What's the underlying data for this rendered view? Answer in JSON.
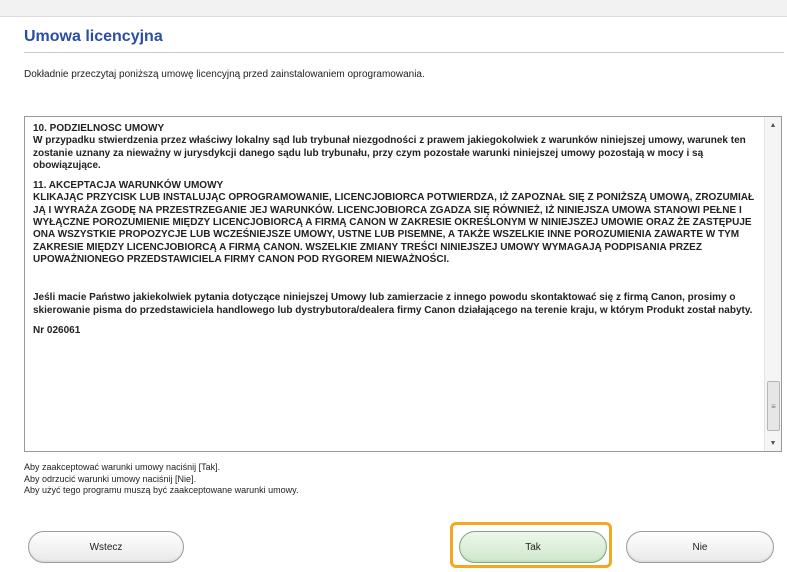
{
  "title": "Umowa licencyjna",
  "instruction": "Dokładnie przeczytaj poniższą umowę licencyjną przed zainstalowaniem oprogramowania.",
  "license": {
    "s10_heading": "10. PODZIELNOŚĆ UMOWY",
    "s10_body": "W przypadku stwierdzenia przez właściwy lokalny sąd lub trybunał niezgodności z prawem jakiegokolwiek z warunków niniejszej umowy, warunek ten zostanie uznany za nieważny w jurysdykcji danego sądu lub trybunału, przy czym pozostałe warunki niniejszej umowy pozostają w mocy i są obowiązujące.",
    "s11_heading": "11. AKCEPTACJA WARUNKÓW UMOWY",
    "s11_body": "KLIKAJĄC PRZYCISK LUB INSTALUJĄC OPROGRAMOWANIE, LICENCJOBIORCA POTWIERDZA, IŻ ZAPOZNAŁ SIĘ Z PONIŻSZĄ UMOWĄ, ZROZUMIAŁ JĄ I WYRAŻA ZGODĘ NA PRZESTRZEGANIE JEJ WARUNKÓW. LICENCJOBIORCA ZGADZA SIĘ RÓWNIEŻ, IŻ NINIEJSZA UMOWA STANOWI PEŁNE I WYŁĄCZNE POROZUMIENIE MIĘDZY LICENCJOBIORCĄ A FIRMĄ CANON W ZAKRESIE OKREŚLONYM W NINIEJSZEJ UMOWIE ORAZ ŻE ZASTĘPUJE ONA WSZYSTKIE PROPOZYCJE LUB WCZEŚNIEJSZE UMOWY, USTNE LUB PISEMNE, A TAKŻE WSZELKIE INNE POROZUMIENIA ZAWARTE W TYM ZAKRESIE MIĘDZY LICENCJOBIORCĄ A FIRMĄ CANON. WSZELKIE ZMIANY TREŚCI NINIEJSZEJ UMOWY WYMAGAJĄ PODPISANIA PRZEZ UPOWAŻNIONEGO PRZEDSTAWICIELA FIRMY CANON POD RYGOREM NIEWAŻNOŚCI.",
    "contact": "Jeśli macie Państwo jakiekolwiek pytania dotyczące niniejszej Umowy lub zamierzacie z innego powodu skontaktować się z firmą Canon, prosimy o skierowanie pisma do przedstawiciela handlowego lub dystrybutora/dealera firmy Canon działającego na terenie kraju, w którym Produkt został nabyty.",
    "ref_number": "Nr 026061"
  },
  "scrollbar": {
    "up_icon": "▲",
    "down_icon": "▼",
    "thumb_grip": "≡"
  },
  "hints": [
    "Aby zaakceptować warunki umowy naciśnij [Tak].",
    "Aby odrzucić warunki umowy naciśnij [Nie].",
    "Aby użyć tego programu muszą być zaakceptowane warunki umowy."
  ],
  "buttons": {
    "back": "Wstecz",
    "yes": "Tak",
    "no": "Nie"
  },
  "colors": {
    "title": "#2b4fa0",
    "focus_ring": "#f5a623",
    "yes_button": "#cfe7cc"
  }
}
